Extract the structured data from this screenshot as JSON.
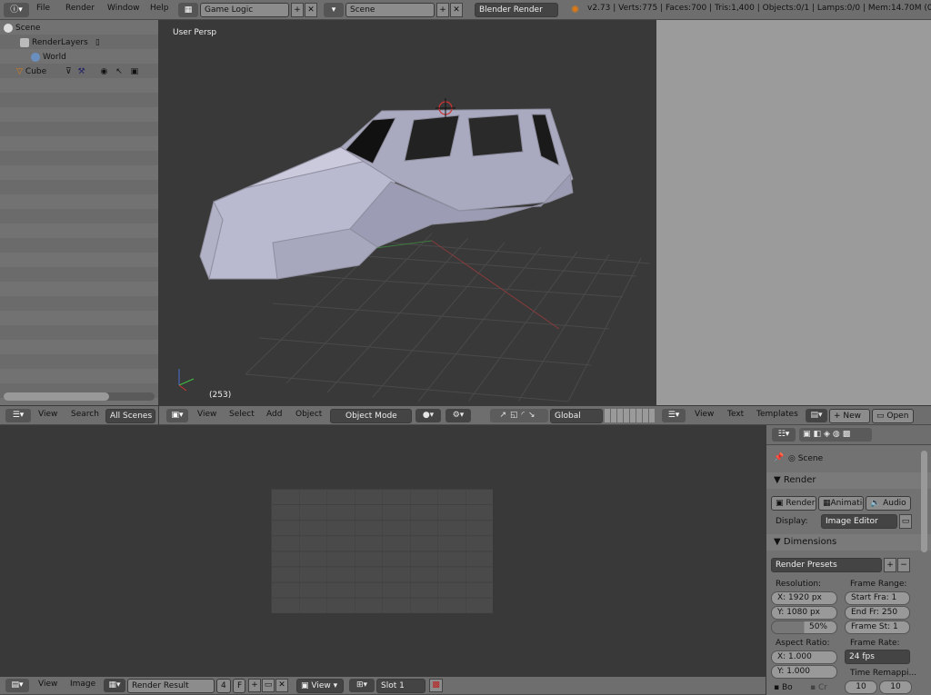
{
  "top_menu": {
    "items": [
      "File",
      "Render",
      "Window",
      "Help"
    ],
    "layout": "Game Logic",
    "scene": "Scene",
    "engine": "Blender Render",
    "stats": "v2.73 | Verts:775 | Faces:700 | Tris:1,400 | Objects:0/1 | Lamps:0/0 | Mem:14.70M (0.11M)"
  },
  "outliner": {
    "items": [
      {
        "label": "Scene"
      },
      {
        "label": "RenderLayers"
      },
      {
        "label": "World"
      },
      {
        "label": "Cube"
      }
    ],
    "footer": {
      "view": "View",
      "search": "Search",
      "scenes": "All Scenes"
    }
  },
  "viewport": {
    "label": "User Persp",
    "frame": "(253)",
    "footer": {
      "view": "View",
      "select": "Select",
      "add": "Add",
      "object": "Object",
      "mode": "Object Mode",
      "orientation": "Global"
    }
  },
  "text_editor": {
    "footer": {
      "view": "View",
      "text": "Text",
      "templates": "Templates",
      "new": "New",
      "open": "Open"
    }
  },
  "image_editor": {
    "footer": {
      "view": "View",
      "image": "Image",
      "result": "Render Result",
      "slot_num": "4",
      "f": "F",
      "view2": "View",
      "slot": "Slot 1"
    }
  },
  "props": {
    "scene": "Scene",
    "render_section": "Render",
    "render_btn": "Render",
    "anim_btn": "Animatio",
    "audio_btn": "Audio",
    "display_label": "Display:",
    "display_value": "Image Editor",
    "dimensions": "Dimensions",
    "presets": "Render Presets",
    "resolution": "Resolution:",
    "res_x": "X:  1920 px",
    "res_y": "Y:  1080 px",
    "res_pct": "50%",
    "frame_range": "Frame Range:",
    "start": "Start Fra:  1",
    "end": "End Fr: 250",
    "step": "Frame St:  1",
    "aspect": "Aspect Ratio:",
    "asp_x": "X:       1.000",
    "asp_y": "Y:       1.000",
    "frame_rate": "Frame Rate:",
    "fps": "24 fps",
    "time_remap": "Time Remappi...",
    "remap_a": "10",
    "remap_b": "10",
    "bo": "Bo",
    "cr": "Cr"
  }
}
